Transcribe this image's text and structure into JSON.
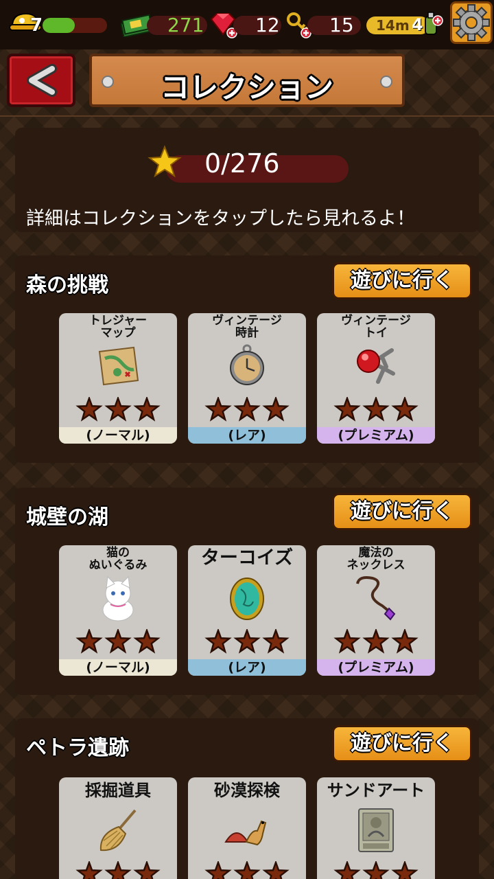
{
  "status": {
    "hp": "7",
    "hp_fraction": 0.5,
    "money": "271",
    "gems": "12",
    "keys": "15",
    "timer": "14m",
    "stamina": "4"
  },
  "header": {
    "title": "コレクション"
  },
  "summary": {
    "progress": "0/276",
    "hint": "詳細はコレクションをタップしたら見れるよ！"
  },
  "stages": [
    {
      "name": "森の挑戦",
      "play_label": "遊びに行く",
      "items": [
        {
          "name": "トレジャー\nマップ",
          "rarity": "(ノーマル)",
          "icon": "treasure-map-icon"
        },
        {
          "name": "ヴィンテージ\n時計",
          "rarity": "(レア)",
          "icon": "pocket-watch-icon"
        },
        {
          "name": "ヴィンテージ\nトイ",
          "rarity": "(プレミアム)",
          "icon": "vintage-toy-icon"
        }
      ]
    },
    {
      "name": "城壁の湖",
      "play_label": "遊びに行く",
      "items": [
        {
          "name": "猫の\nぬいぐるみ",
          "rarity": "(ノーマル)",
          "icon": "cat-plush-icon"
        },
        {
          "name": "ターコイズ",
          "rarity": "(レア)",
          "icon": "turquoise-icon"
        },
        {
          "name": "魔法の\nネックレス",
          "rarity": "(プレミアム)",
          "icon": "necklace-icon"
        }
      ]
    },
    {
      "name": "ペトラ遺跡",
      "play_label": "遊びに行く",
      "items": [
        {
          "name": "採掘道具",
          "icon": "broom-icon"
        },
        {
          "name": "砂漠探検",
          "icon": "camel-icon"
        },
        {
          "name": "サンドアート",
          "icon": "sand-art-icon"
        }
      ]
    }
  ],
  "colors": {
    "normal": "#ece6d4",
    "rare": "#8fbfd9",
    "premium": "#d5b3ec",
    "button": "#f0a020",
    "back": "#a50e14"
  }
}
